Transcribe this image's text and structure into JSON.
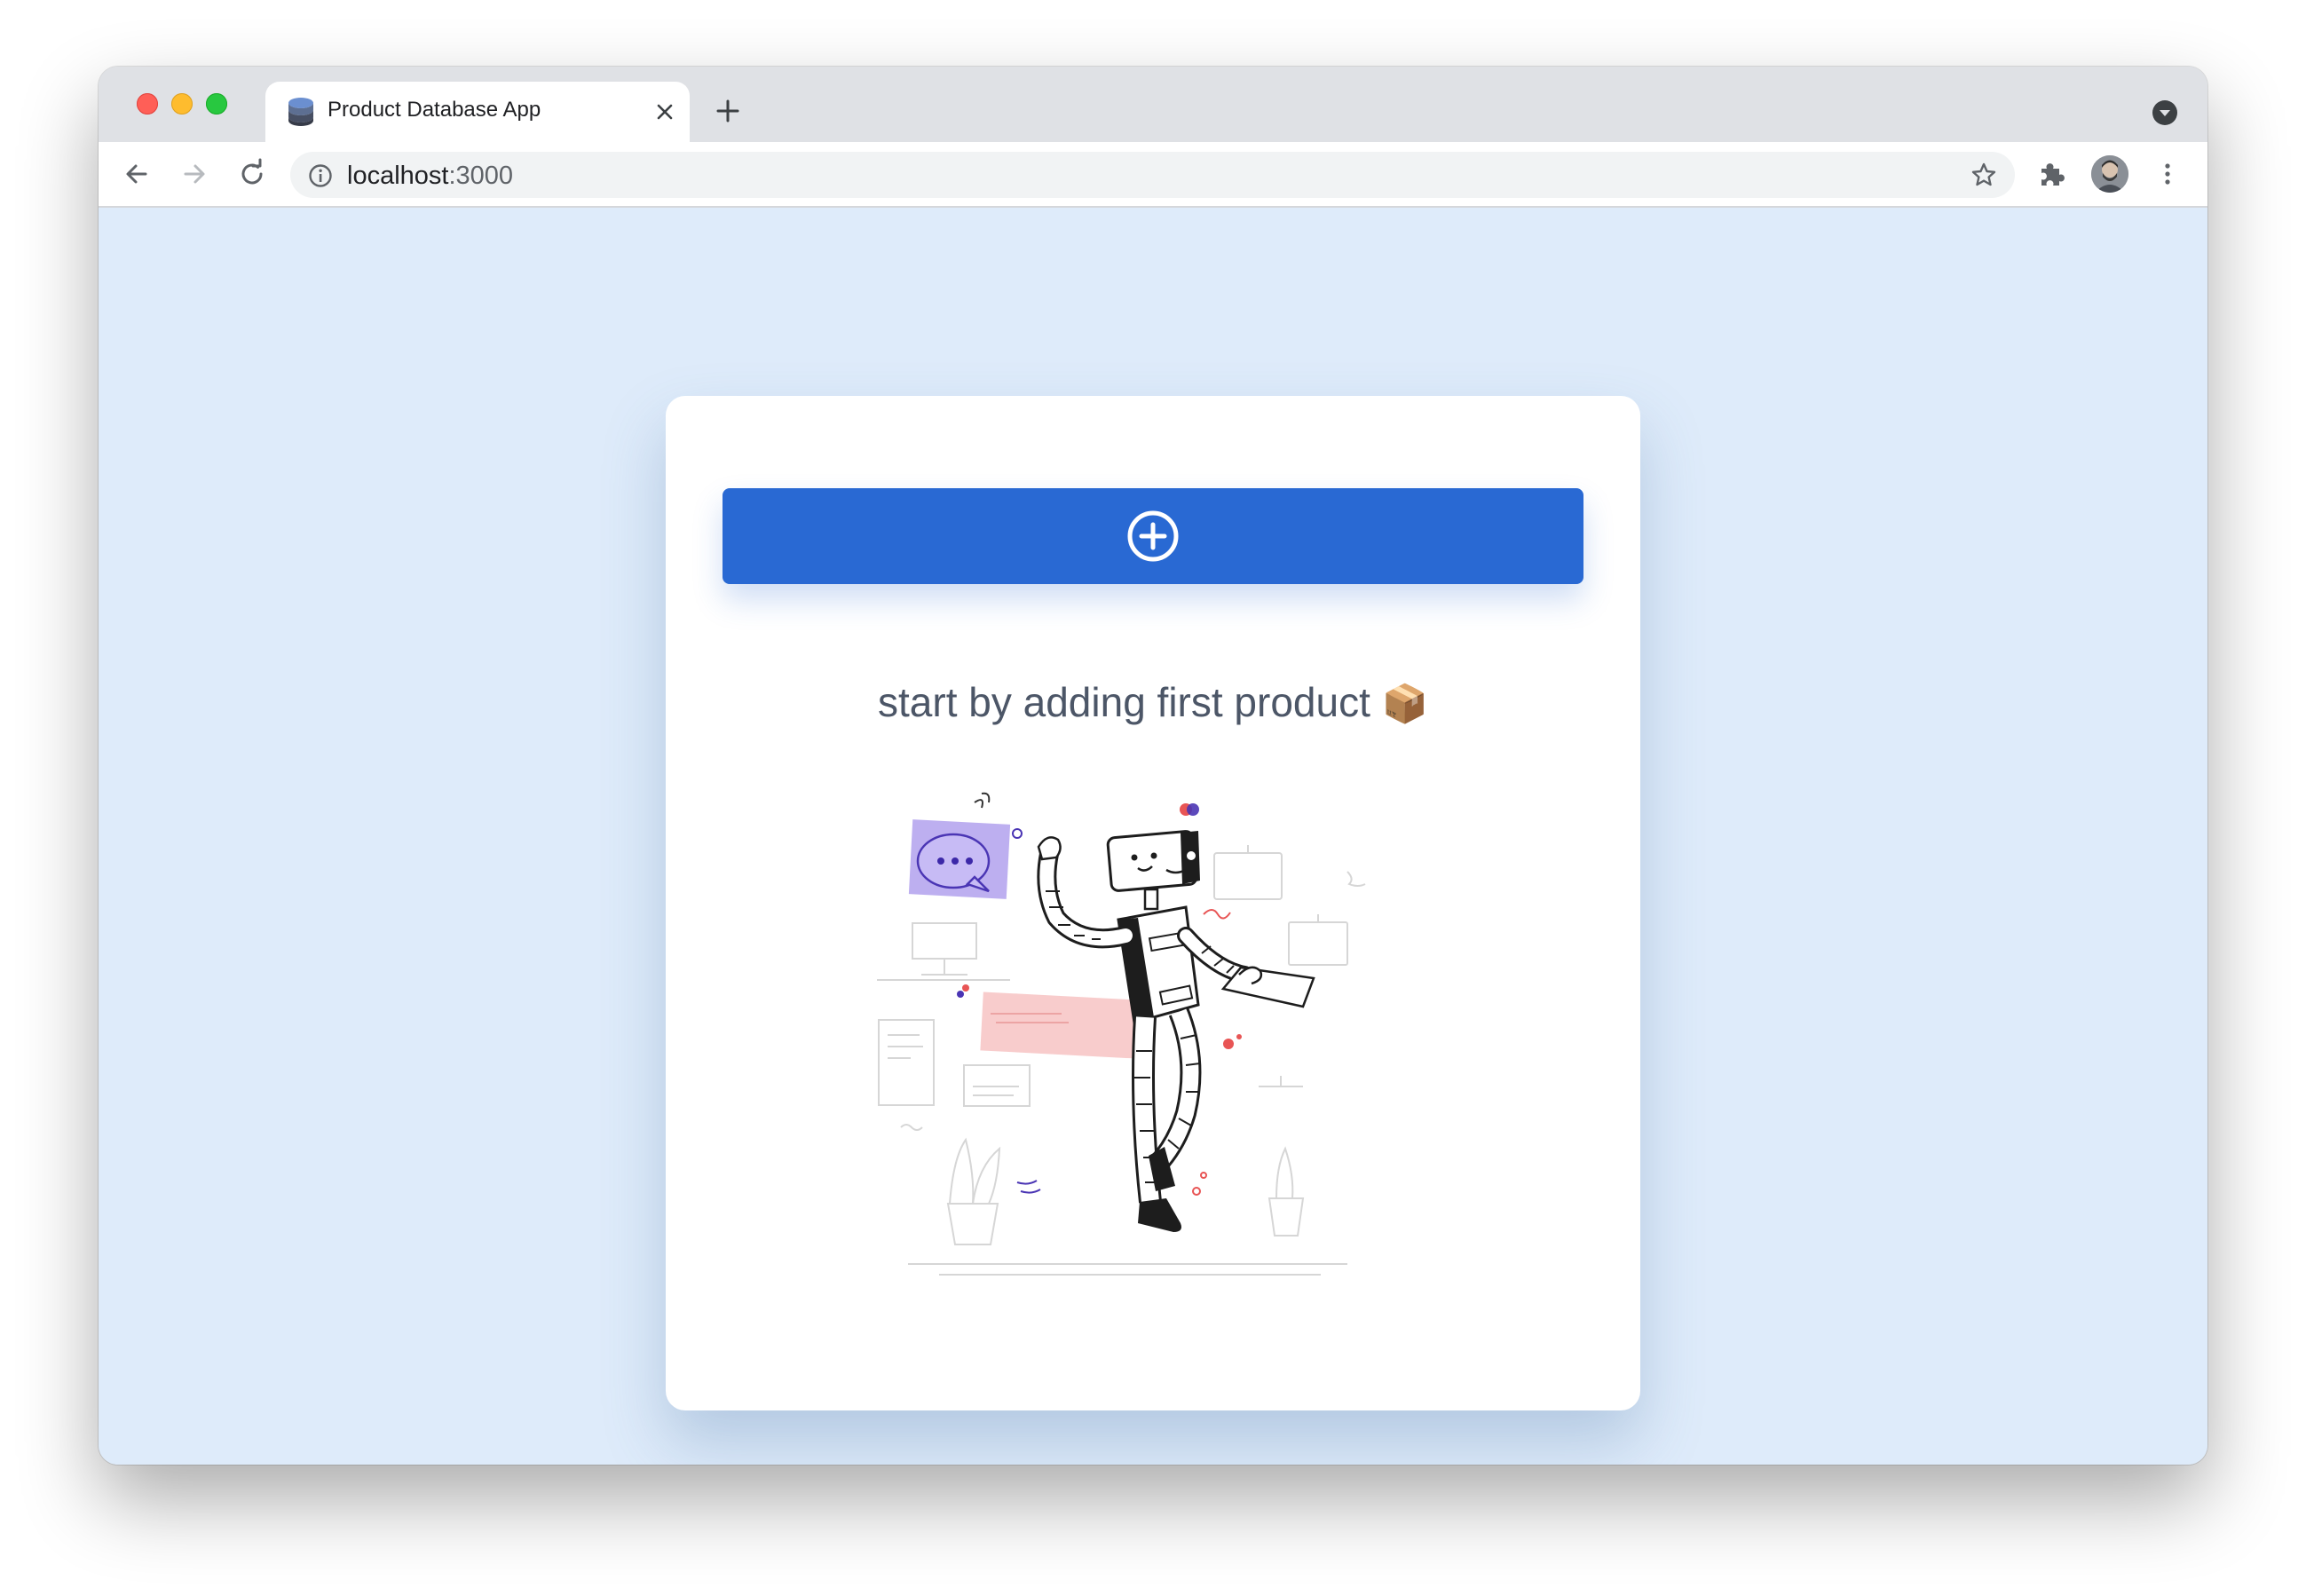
{
  "browser": {
    "tab": {
      "title": "Product Database App",
      "favicon": "database-icon"
    },
    "address_bar": {
      "host": "localhost",
      "port": ":3000"
    },
    "icons": {
      "back": "arrow-left-icon",
      "forward": "arrow-right-icon",
      "reload": "reload-icon",
      "info": "info-icon",
      "bookmark": "star-icon",
      "extensions": "puzzle-icon",
      "menu": "kebab-icon"
    }
  },
  "page": {
    "add_button": {
      "icon": "plus-circle-icon",
      "color": "#2969d3"
    },
    "empty_state": {
      "message": "start by adding first product",
      "emoji": "📦"
    },
    "background": "#deebfa"
  }
}
